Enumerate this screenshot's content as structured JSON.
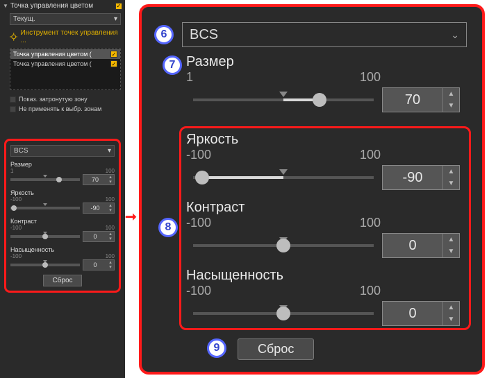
{
  "left": {
    "section_title": "Точка управления цветом",
    "dropdown_value": "Текущ.",
    "tool_label": "Инструмент точек управления ...",
    "items": [
      {
        "label": "Точка управления цветом (",
        "checked": true,
        "selected": true
      },
      {
        "label": "Точка управления цветом (",
        "checked": true,
        "selected": false
      }
    ],
    "show_zone": "Показ. затронутую зону",
    "not_apply": "Не применять к выбр. зонам"
  },
  "mini": {
    "dropdown": "BCS",
    "sliders": [
      {
        "label": "Размер",
        "min": "1",
        "max": "100",
        "value": "70",
        "thumb_pct": 70,
        "tick_pct": 50
      },
      {
        "label": "Яркость",
        "min": "-100",
        "max": "100",
        "value": "-90",
        "thumb_pct": 5,
        "tick_pct": 50
      },
      {
        "label": "Контраст",
        "min": "-100",
        "max": "100",
        "value": "0",
        "thumb_pct": 50,
        "tick_pct": 50
      },
      {
        "label": "Насыщенность",
        "min": "-100",
        "max": "100",
        "value": "0",
        "thumb_pct": 50,
        "tick_pct": 50
      }
    ],
    "reset": "Сброс"
  },
  "zoom": {
    "dropdown": "BCS",
    "size": {
      "label": "Размер",
      "min": "1",
      "max": "100",
      "value": "70",
      "thumb_pct": 70,
      "tick_pct": 50,
      "fill_from": 50,
      "fill_to": 70
    },
    "brightness": {
      "label": "Яркость",
      "min": "-100",
      "max": "100",
      "value": "-90",
      "thumb_pct": 5,
      "tick_pct": 50,
      "fill_from": 5,
      "fill_to": 50
    },
    "contrast": {
      "label": "Контраст",
      "min": "-100",
      "max": "100",
      "value": "0",
      "thumb_pct": 50,
      "tick_pct": 50
    },
    "saturation": {
      "label": "Насыщенность",
      "min": "-100",
      "max": "100",
      "value": "0",
      "thumb_pct": 50,
      "tick_pct": 50
    },
    "reset": "Сброс"
  },
  "callouts": {
    "c6": "6",
    "c7": "7",
    "c8": "8",
    "c9": "9"
  }
}
